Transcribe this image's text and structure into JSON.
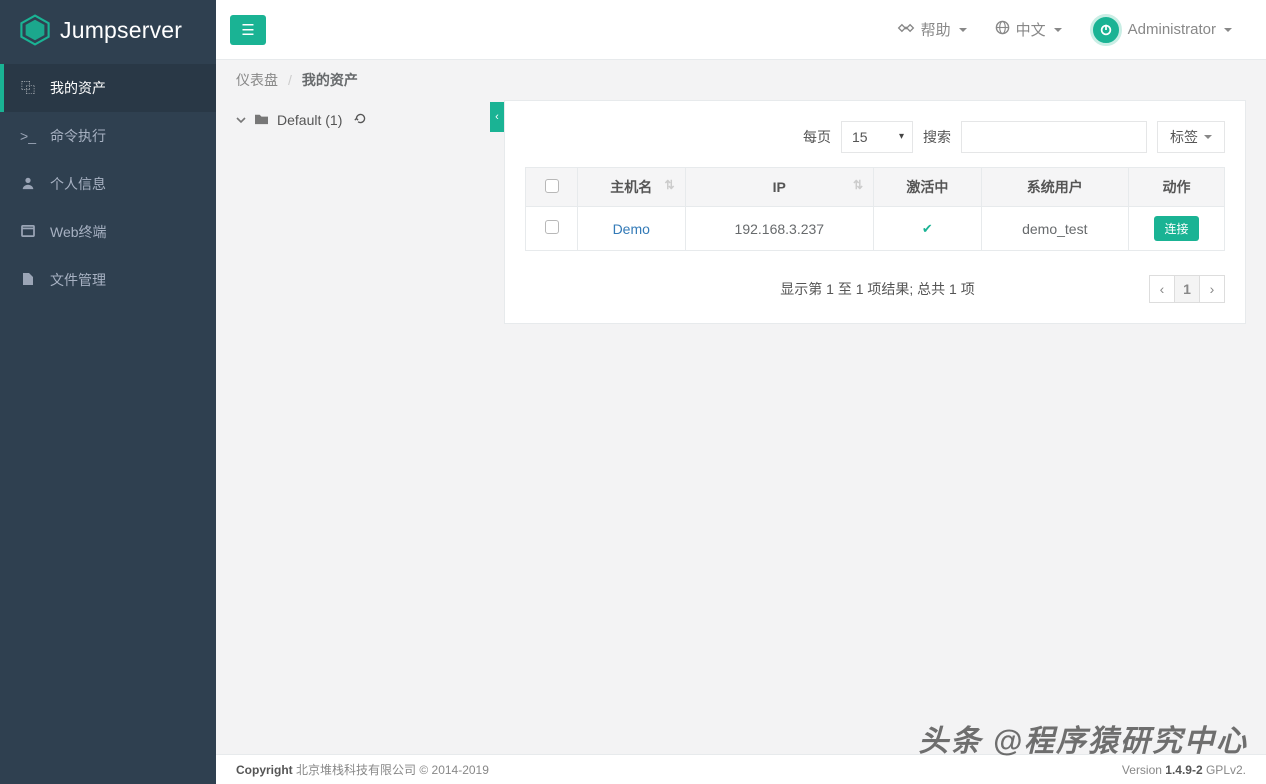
{
  "brand": {
    "name": "Jumpserver"
  },
  "sidebar": {
    "items": [
      {
        "label": "我的资产",
        "icon": "copy-icon"
      },
      {
        "label": "命令执行",
        "icon": "terminal-icon"
      },
      {
        "label": "个人信息",
        "icon": "user-icon"
      },
      {
        "label": "Web终端",
        "icon": "window-icon"
      },
      {
        "label": "文件管理",
        "icon": "file-icon"
      }
    ]
  },
  "topbar": {
    "help": "帮助",
    "lang": "中文",
    "user": "Administrator"
  },
  "breadcrumb": {
    "root": "仪表盘",
    "current": "我的资产"
  },
  "tree": {
    "root_label": "Default (1)"
  },
  "table": {
    "per_page_label": "每页",
    "per_page_value": "15",
    "search_label": "搜索",
    "tag_label": "标签",
    "columns": {
      "hostname": "主机名",
      "ip": "IP",
      "active": "激活中",
      "system_user": "系统用户",
      "action": "动作"
    },
    "rows": [
      {
        "hostname": "Demo",
        "ip": "192.168.3.237",
        "active": true,
        "system_user": "demo_test",
        "action_label": "连接"
      }
    ],
    "info": "显示第 1 至 1 项结果; 总共 1 项",
    "pagination": {
      "prev": "‹",
      "pages": [
        "1"
      ],
      "next": "›"
    }
  },
  "footer": {
    "copyright_strong": "Copyright",
    "copyright_rest": " 北京堆栈科技有限公司 © 2014-2019",
    "version_label": "Version ",
    "version": "1.4.9-2",
    "license": " GPLv2."
  },
  "watermark": "头条 @程序猿研究中心"
}
